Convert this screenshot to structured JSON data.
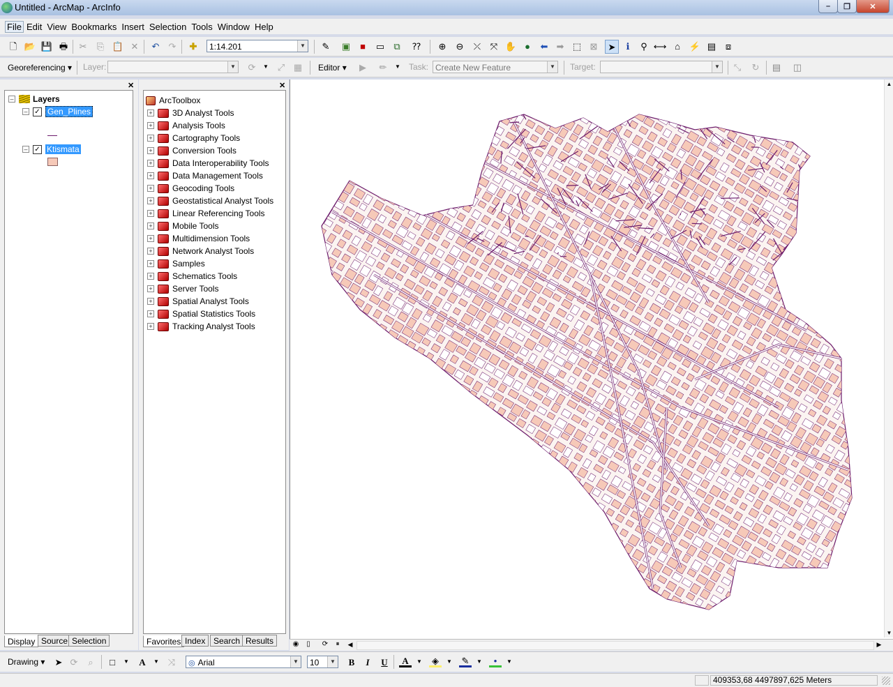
{
  "window": {
    "title": "Untitled - ArcMap - ArcInfo",
    "minimize": "–",
    "maximize": "❐",
    "close": "✕"
  },
  "menubar": [
    "File",
    "Edit",
    "View",
    "Bookmarks",
    "Insert",
    "Selection",
    "Tools",
    "Window",
    "Help"
  ],
  "toolbar1": {
    "scale": "1:14.201"
  },
  "toolbar2": {
    "georeferencing_label": "Georeferencing",
    "layer_label": "Layer:",
    "layer_value": "",
    "editor_label": "Editor",
    "task_label": "Task:",
    "task_value": "Create New Feature",
    "target_label": "Target:",
    "target_value": ""
  },
  "toc": {
    "root_label": "Layers",
    "layers": [
      {
        "name": "Gen_Plines",
        "checked": true,
        "symbol": "line",
        "color": "#6b1a6b"
      },
      {
        "name": "Ktismata",
        "checked": true,
        "symbol": "fill",
        "color": "#f6c9b8"
      }
    ],
    "tabs": [
      "Display",
      "Source",
      "Selection"
    ]
  },
  "arctoolbox": {
    "root_label": "ArcToolbox",
    "toolboxes": [
      "3D Analyst Tools",
      "Analysis Tools",
      "Cartography Tools",
      "Conversion Tools",
      "Data Interoperability Tools",
      "Data Management Tools",
      "Geocoding Tools",
      "Geostatistical Analyst Tools",
      "Linear Referencing Tools",
      "Mobile Tools",
      "Multidimension Tools",
      "Network Analyst Tools",
      "Samples",
      "Schematics Tools",
      "Server Tools",
      "Spatial Analyst Tools",
      "Spatial Statistics Tools",
      "Tracking Analyst Tools"
    ],
    "tabs": [
      "Favorites",
      "Index",
      "Search",
      "Results"
    ]
  },
  "drawing_toolbar": {
    "drawing_label": "Drawing",
    "font_name": "Arial",
    "font_size": "10",
    "bold": "B",
    "italic": "I",
    "underline": "U"
  },
  "status": {
    "coordinates": "409353,68  4497897,625 Meters"
  },
  "colors": {
    "line": "#6b1a6b",
    "fill": "#f6c9b8",
    "selection": "#3399ff"
  }
}
